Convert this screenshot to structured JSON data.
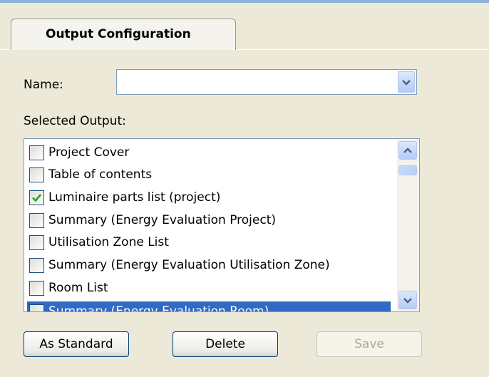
{
  "tab": {
    "label": "Output Configuration"
  },
  "name_field": {
    "label": "Name:",
    "value": ""
  },
  "selected_output": {
    "label": "Selected Output:",
    "items": [
      {
        "label": "Project Cover",
        "checked": false
      },
      {
        "label": "Table of contents",
        "checked": false
      },
      {
        "label": "Luminaire parts list (project)",
        "checked": true
      },
      {
        "label": "Summary (Energy Evaluation Project)",
        "checked": false
      },
      {
        "label": "Utilisation Zone List",
        "checked": false
      },
      {
        "label": "Summary (Energy Evaluation Utilisation Zone)",
        "checked": false
      },
      {
        "label": "Room List",
        "checked": false
      },
      {
        "label": "Summary (Energy Evaluation Room)",
        "checked": false
      }
    ]
  },
  "buttons": {
    "as_standard": "As Standard",
    "delete": "Delete",
    "save": "Save"
  },
  "icons": {
    "combo_arrow": "chevron-down-icon",
    "scroll_up": "chevron-up-icon",
    "scroll_down": "chevron-down-icon",
    "check": "check-icon"
  },
  "colors": {
    "background": "#ECE9D8",
    "selection": "#316AC5",
    "check": "#21A121",
    "field_border": "#7F9DB9"
  }
}
